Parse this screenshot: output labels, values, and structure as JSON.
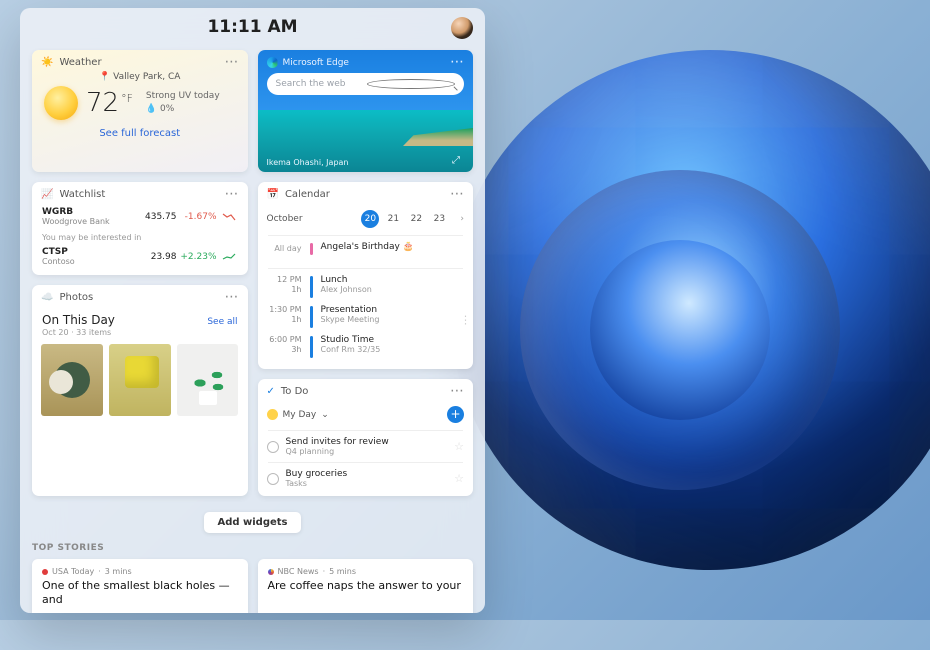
{
  "header": {
    "time": "11:11 AM"
  },
  "weather": {
    "widget_title": "Weather",
    "location_prefix": "📍",
    "location": "Valley Park, CA",
    "temp": "72",
    "unit": "°F",
    "line1": "Strong UV today",
    "line2": "💧 0%",
    "link": "See full forecast"
  },
  "edge": {
    "widget_title": "Microsoft Edge",
    "search_placeholder": "Search the web",
    "caption": "Ikema Ohashi, Japan"
  },
  "watchlist": {
    "widget_title": "Watchlist",
    "rows": [
      {
        "sym": "WGRB",
        "name": "Woodgrove Bank",
        "price": "435.75",
        "change": "-1.67%",
        "dir": "neg"
      },
      {
        "sym": "CTSP",
        "name": "Contoso",
        "price": "23.98",
        "change": "+2.23%",
        "dir": "pos"
      }
    ],
    "interest_note": "You may be interested in"
  },
  "calendar": {
    "widget_title": "Calendar",
    "month": "October",
    "days": [
      "20",
      "21",
      "22",
      "23"
    ],
    "selected_index": 0,
    "allday_label": "All day",
    "allday_event": "Angela's Birthday 🎂",
    "events": [
      {
        "time": "12 PM",
        "dur": "1h",
        "title": "Lunch",
        "sub": "Alex Johnson"
      },
      {
        "time": "1:30 PM",
        "dur": "1h",
        "title": "Presentation",
        "sub": "Skype Meeting"
      },
      {
        "time": "6:00 PM",
        "dur": "3h",
        "title": "Studio Time",
        "sub": "Conf Rm 32/35"
      }
    ]
  },
  "photos": {
    "widget_title": "Photos",
    "heading": "On This Day",
    "sub": "Oct 20 · 33 items",
    "see_all": "See all"
  },
  "todo": {
    "widget_title": "To Do",
    "list_name": "My Day",
    "chevron": "⌄",
    "items": [
      {
        "title": "Send invites for review",
        "sub": "Q4 planning"
      },
      {
        "title": "Buy groceries",
        "sub": "Tasks"
      }
    ]
  },
  "add_widgets": "Add widgets",
  "top_stories": {
    "label": "TOP STORIES",
    "cards": [
      {
        "source": "USA Today",
        "age": "3 mins",
        "title": "One of the smallest black holes — and"
      },
      {
        "source": "NBC News",
        "age": "5 mins",
        "title": "Are coffee naps the answer to your"
      }
    ]
  }
}
